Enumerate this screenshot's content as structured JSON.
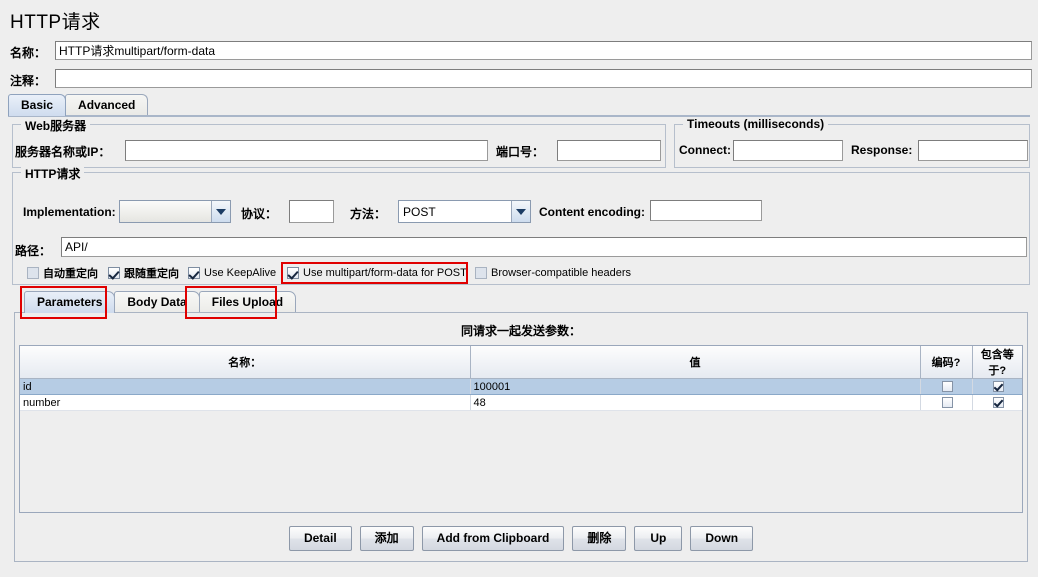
{
  "window": {
    "title": "HTTP请求"
  },
  "name_row": {
    "label": "名称：",
    "value": "HTTP请求multipart/form-data"
  },
  "comment_row": {
    "label": "注释：",
    "value": ""
  },
  "main_tabs": [
    {
      "label": "Basic",
      "active": true
    },
    {
      "label": "Advanced",
      "active": false
    }
  ],
  "web_server": {
    "group_title": "Web服务器",
    "server_label": "服务器名称或IP：",
    "server_value": "",
    "port_label": "端口号：",
    "port_value": ""
  },
  "timeouts": {
    "group_title": "Timeouts (milliseconds)",
    "connect_label": "Connect:",
    "connect_value": "",
    "response_label": "Response:",
    "response_value": ""
  },
  "http_request": {
    "group_title": "HTTP请求",
    "implementation_label": "Implementation:",
    "implementation_value": "",
    "protocol_label": "协议：",
    "protocol_value": "",
    "method_label": "方法：",
    "method_value": "POST",
    "content_encoding_label": "Content encoding:",
    "content_encoding_value": "",
    "path_label": "路径：",
    "path_value": "API/"
  },
  "checkboxes": [
    {
      "label": "自动重定向",
      "checked": false,
      "disabled": true
    },
    {
      "label": "跟随重定向",
      "checked": true,
      "disabled": false
    },
    {
      "label": "Use KeepAlive",
      "checked": true,
      "disabled": false
    },
    {
      "label": "Use multipart/form-data for POST",
      "checked": true,
      "disabled": false
    },
    {
      "label": "Browser-compatible headers",
      "checked": false,
      "disabled": true
    }
  ],
  "inner_tabs": [
    {
      "label": "Parameters",
      "active": true
    },
    {
      "label": "Body Data",
      "active": false
    },
    {
      "label": "Files Upload",
      "active": false
    }
  ],
  "params": {
    "caption": "同请求一起发送参数：",
    "columns": [
      "名称：",
      "值",
      "编码?",
      "包含等于?"
    ],
    "rows": [
      {
        "name": "id",
        "value": "100001",
        "encode": false,
        "include_equals": true,
        "selected": true
      },
      {
        "name": "number",
        "value": "48",
        "encode": false,
        "include_equals": true,
        "selected": false
      }
    ]
  },
  "buttons": [
    {
      "label": "Detail"
    },
    {
      "label": "添加"
    },
    {
      "label": "Add from Clipboard"
    },
    {
      "label": "删除"
    },
    {
      "label": "Up"
    },
    {
      "label": "Down"
    }
  ],
  "annotations": {
    "highlight_color": "#e00000",
    "boxes": [
      {
        "name": "multipart-checkbox-highlight"
      },
      {
        "name": "parameters-tab-highlight"
      },
      {
        "name": "files-upload-tab-highlight"
      }
    ]
  }
}
